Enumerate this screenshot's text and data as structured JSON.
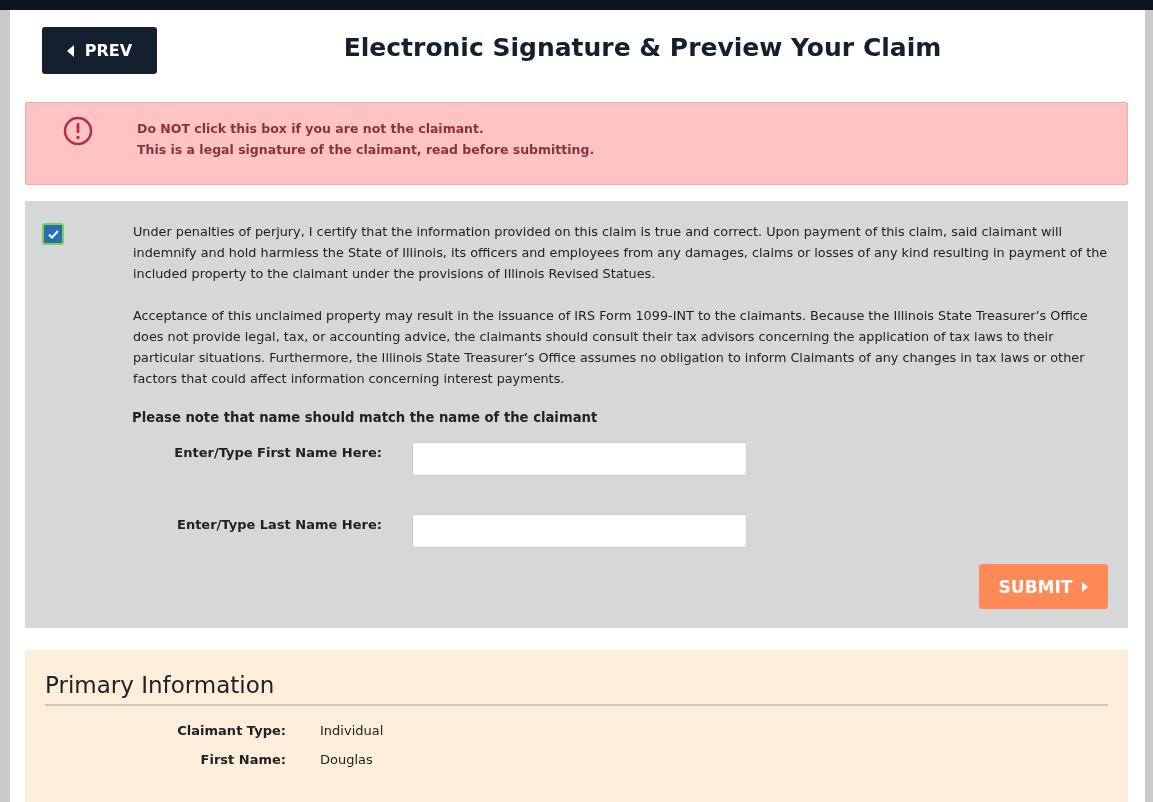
{
  "header": {
    "prev_button": "PREV",
    "title": "Electronic Signature & Preview Your Claim"
  },
  "alert": {
    "lines": [
      "Do NOT click this box if you are not the claimant.",
      "This is a legal signature of the claimant, read before submitting."
    ]
  },
  "certification": {
    "checked": true,
    "paragraphs": [
      "Under penalties of perjury, I certify that the information provided on this claim is true and correct. Upon payment of this claim, said claimant will indemnify and hold harmless the State of Illinois, its officers and employees from any damages, claims or losses of any kind resulting in payment of the included property to the claimant under the provisions of Illinois Revised Statues.",
      "Acceptance of this unclaimed property may result in the issuance of IRS Form 1099-INT to the claimants. Because the Illinois State Treasurer’s Office does not provide legal, tax, or accounting advice, the claimants should consult their tax advisors concerning the application of tax laws to their particular situations. Furthermore, the Illinois State Treasurer’s Office assumes no obligation to inform Claimants of any changes in tax laws or other factors that could affect information concerning interest payments."
    ],
    "note": "Please note that name should match the name of the claimant",
    "fields": [
      {
        "label": "Enter/Type First Name Here:"
      },
      {
        "label": "Enter/Type Last Name Here:"
      }
    ],
    "submit_button": "SUBMIT"
  },
  "primary_information": {
    "title": "Primary Information",
    "rows": [
      {
        "label": "Claimant Type:",
        "value": "Individual"
      },
      {
        "label": "First Name:",
        "value": "Douglas"
      }
    ]
  }
}
